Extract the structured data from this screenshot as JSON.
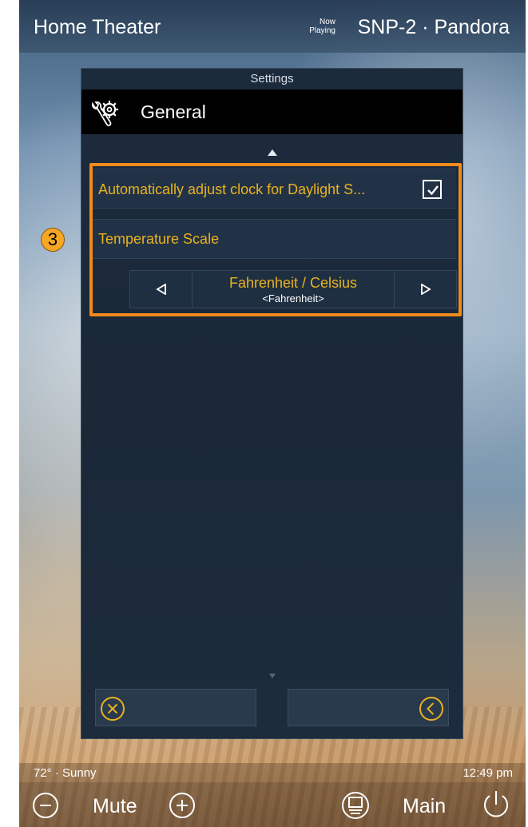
{
  "header": {
    "room_title": "Home Theater",
    "now_playing_line1": "Now",
    "now_playing_line2": "Playing",
    "source": "SNP-2 · Pandora"
  },
  "panel": {
    "caption": "Settings",
    "title": "General",
    "title_icon": "wrench-gear-icon",
    "settings": {
      "dst_label": "Automatically adjust clock for Daylight S...",
      "dst_checked": true,
      "temperature_label": "Temperature Scale",
      "temperature_option_title": "Fahrenheit / Celsius",
      "temperature_option_value": "<Fahrenheit>"
    },
    "footer": {
      "cancel_icon": "close-circle-icon",
      "back_icon": "back-circle-icon"
    }
  },
  "annotation": {
    "step_number": "3",
    "highlight_color": "#f08a1c"
  },
  "status": {
    "weather": "72° · Sunny",
    "time": "12:49 pm"
  },
  "controls": {
    "mute_label": "Mute",
    "main_label": "Main"
  },
  "colors": {
    "accent": "#e8b21e",
    "panel_bg": "#1c2b3c",
    "header_bg": "#000000"
  }
}
